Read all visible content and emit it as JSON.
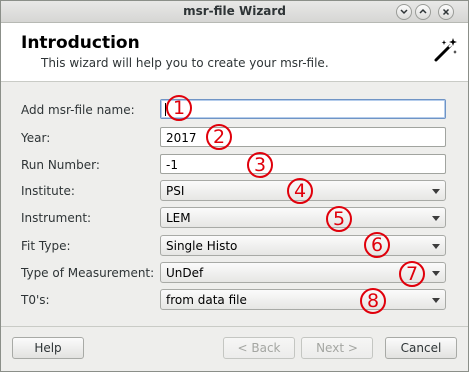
{
  "window": {
    "title": "msr-file Wizard"
  },
  "header": {
    "title": "Introduction",
    "subtitle": "This wizard will help you to create your msr-file."
  },
  "form": {
    "fields": [
      {
        "label": "Add msr-file name:",
        "value": "",
        "badge": "1"
      },
      {
        "label": "Year:",
        "value": "2017",
        "badge": "2"
      },
      {
        "label": "Run Number:",
        "value": "-1",
        "badge": "3"
      },
      {
        "label": "Institute:",
        "value": "PSI",
        "badge": "4"
      },
      {
        "label": "Instrument:",
        "value": "LEM",
        "badge": "5"
      },
      {
        "label": "Fit Type:",
        "value": "Single Histo",
        "badge": "6"
      },
      {
        "label": "Type of Measurement:",
        "value": "UnDef",
        "badge": "7"
      },
      {
        "label": "T0's:",
        "value": "from data file",
        "badge": "8"
      }
    ]
  },
  "buttons": {
    "help": "Help",
    "back": "< Back",
    "next": "Next >",
    "cancel": "Cancel"
  },
  "colors": {
    "annotation": "#e0000b",
    "focus": "#6f94c5"
  },
  "icons": {
    "wizard": "magic-wand-icon",
    "minimize": "chevron-down-icon",
    "maximize": "chevron-up-icon",
    "close": "close-icon"
  }
}
